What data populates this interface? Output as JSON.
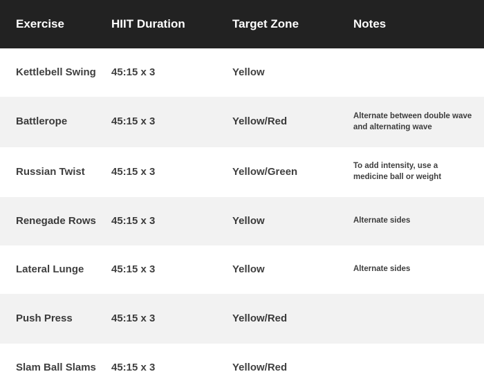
{
  "table": {
    "columns": [
      {
        "key": "exercise",
        "label": "Exercise"
      },
      {
        "key": "duration",
        "label": "HIIT Duration"
      },
      {
        "key": "zone",
        "label": "Target Zone"
      },
      {
        "key": "notes",
        "label": "Notes"
      }
    ],
    "header_background": "#222222",
    "header_text_color": "#ffffff",
    "row_background": "#ffffff",
    "row_alt_background": "#f2f2f2",
    "body_text_color": "#3f3f3f",
    "rows": [
      {
        "exercise": "Kettlebell Swing",
        "duration": "45:15 x 3",
        "zone": "Yellow",
        "notes": ""
      },
      {
        "exercise": "Battlerope",
        "duration": "45:15 x 3",
        "zone": "Yellow/Red",
        "notes": "Alternate between double wave and alternating wave"
      },
      {
        "exercise": "Russian Twist",
        "duration": "45:15 x 3",
        "zone": "Yellow/Green",
        "notes": "To add intensity, use a medicine ball or weight"
      },
      {
        "exercise": "Renegade Rows",
        "duration": "45:15 x 3",
        "zone": "Yellow",
        "notes": "Alternate sides"
      },
      {
        "exercise": "Lateral Lunge",
        "duration": "45:15 x 3",
        "zone": "Yellow",
        "notes": "Alternate sides"
      },
      {
        "exercise": "Push Press",
        "duration": "45:15 x 3",
        "zone": "Yellow/Red",
        "notes": ""
      },
      {
        "exercise": "Slam Ball Slams",
        "duration": "45:15 x 3",
        "zone": "Yellow/Red",
        "notes": ""
      }
    ]
  }
}
